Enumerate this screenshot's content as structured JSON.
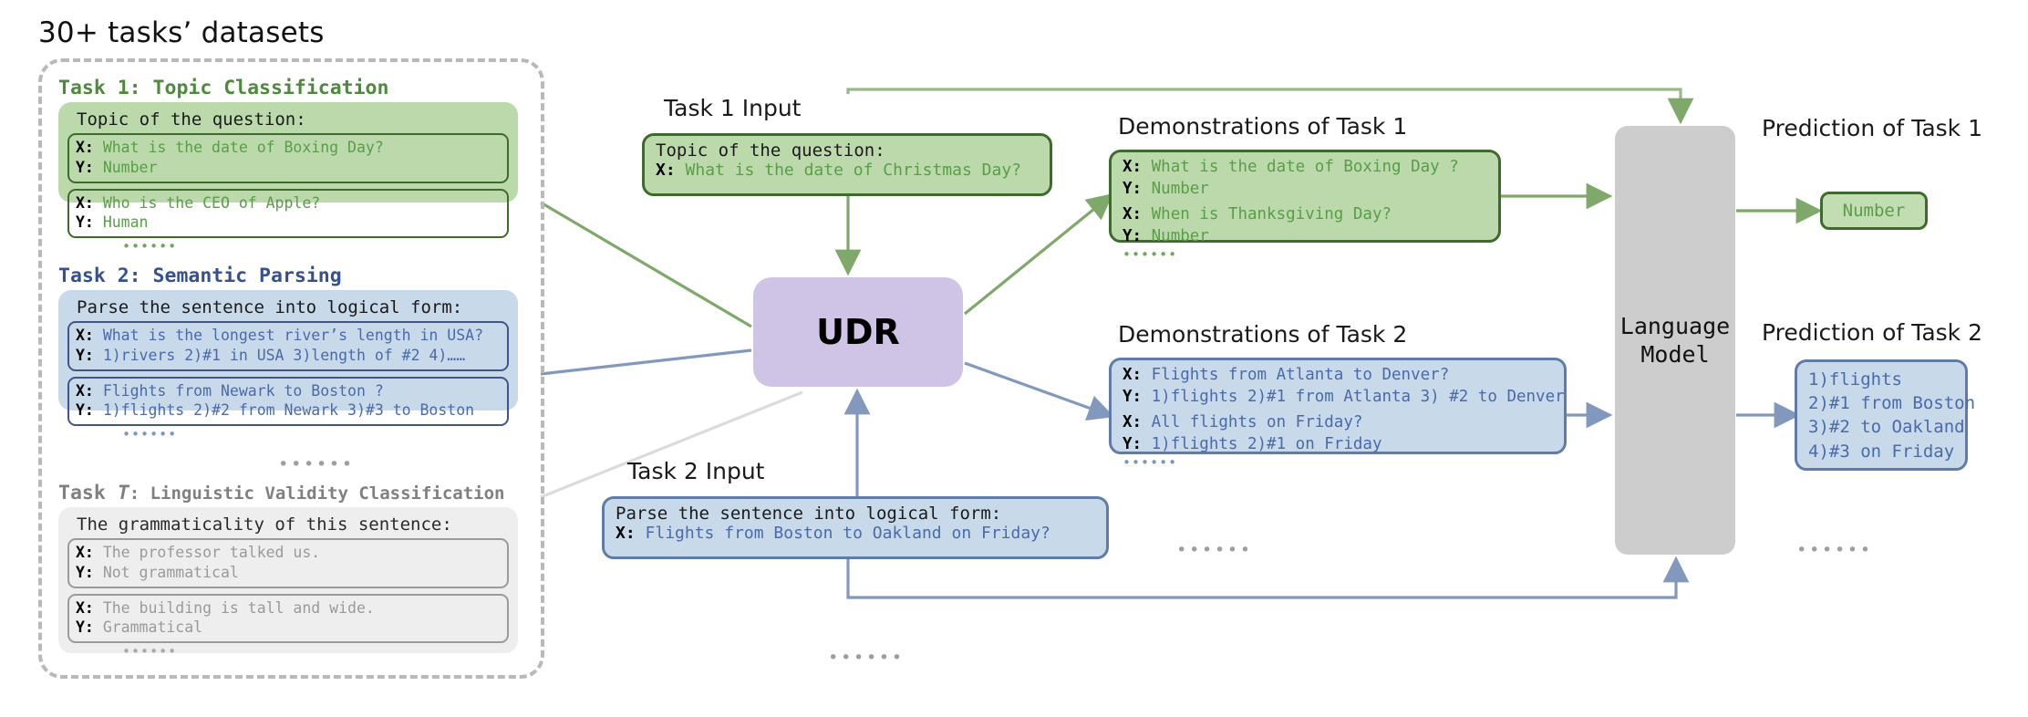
{
  "page": {
    "title": "30+ tasks’ datasets"
  },
  "colors": {
    "green_fill": "#bcd9ac",
    "green_stroke": "#3e6b2d",
    "green_text": "#5a9d49",
    "green_heading": "#4e8a3c",
    "blue_fill": "#c8d9ea",
    "blue_stroke": "#5f7ca8",
    "blue_text": "#4a6aaa",
    "blue_heading": "#35518f",
    "gray_fill": "#eeeeee",
    "gray_stroke": "#9a9a9a",
    "gray_text": "#9a9a9a",
    "udr_fill": "#cfc4e6",
    "lm_fill": "#cdcdcd",
    "dashed_border": "#b9b9b9"
  },
  "datasets_panel": {
    "tasks": [
      {
        "heading": "Task 1: Topic Classification",
        "prompt": "Topic of the question:",
        "examples": [
          {
            "x_label": "X:",
            "x": "What is the date of Boxing Day?",
            "y_label": "Y:",
            "y": "Number"
          },
          {
            "x_label": "X:",
            "x": "Who is the CEO of Apple?",
            "y_label": "Y:",
            "y": "Human"
          }
        ],
        "ellipsis": "••••••"
      },
      {
        "heading": "Task 2: Semantic Parsing",
        "prompt": "Parse the sentence into logical form:",
        "examples": [
          {
            "x_label": "X:",
            "x": "What is the longest river’s length in USA?",
            "y_label": "Y:",
            "y": "1)rivers 2)#1 in USA 3)length of #2 4)……"
          },
          {
            "x_label": "X:",
            "x": "Flights from Newark to Boston ?",
            "y_label": "Y:",
            "y": "1)flights 2)#2 from Newark 3)#3 to Boston"
          }
        ],
        "ellipsis": "••••••"
      },
      {
        "heading_prefix": "Task ",
        "heading_tnum": "T",
        "heading_suffix": ": Linguistic Validity Classification",
        "prompt": "The grammaticality of this sentence:",
        "examples": [
          {
            "x_label": "X:",
            "x": "The professor talked us.",
            "y_label": "Y:",
            "y": "Not grammatical"
          },
          {
            "x_label": "X:",
            "x": "The building is tall and wide.",
            "y_label": "Y:",
            "y": "Grammatical"
          }
        ],
        "ellipsis": "••••••"
      }
    ],
    "between_tasks_ellipsis": "••••••"
  },
  "inputs": {
    "task1": {
      "label": "Task 1 Input",
      "prompt": "Topic of the question:",
      "x_label": "X:",
      "x": "What is the date of Christmas Day?"
    },
    "task2": {
      "label": "Task 2 Input",
      "prompt": "Parse the sentence into logical form:",
      "x_label": "X:",
      "x": "Flights from Boston to Oakland on Friday?"
    }
  },
  "demonstrations": {
    "task1": {
      "label": "Demonstrations of Task 1",
      "examples": [
        {
          "x_label": "X:",
          "x": "What is the date of Boxing Day ?",
          "y_label": "Y:",
          "y": "Number"
        },
        {
          "x_label": "X:",
          "x": "When is Thanksgiving Day?",
          "y_label": "Y:",
          "y": "Number"
        }
      ],
      "ellipsis": "••••••"
    },
    "task2": {
      "label": "Demonstrations of Task 2",
      "examples": [
        {
          "x_label": "X:",
          "x": "Flights from Atlanta to Denver?",
          "y_label": "Y:",
          "y": "1)flights 2)#1 from Atlanta 3) #2 to Denver"
        },
        {
          "x_label": "X:",
          "x": "All flights on Friday?",
          "y_label": "Y:",
          "y": "1)flights 2)#1 on Friday"
        }
      ],
      "ellipsis": "••••••"
    }
  },
  "udr": {
    "label": "UDR"
  },
  "language_model": {
    "line1": "Language",
    "line2": "Model"
  },
  "predictions": {
    "task1": {
      "label": "Prediction of Task 1",
      "value": "Number"
    },
    "task2": {
      "label": "Prediction of Task 2",
      "lines": [
        "1)flights",
        "2)#1 from Boston",
        "3)#2 to Oakland",
        "4)#3 on Friday"
      ]
    }
  },
  "ellipses": {
    "middle_bottom": "••••••",
    "center_lower": "••••••",
    "right_lower": "••••••"
  }
}
